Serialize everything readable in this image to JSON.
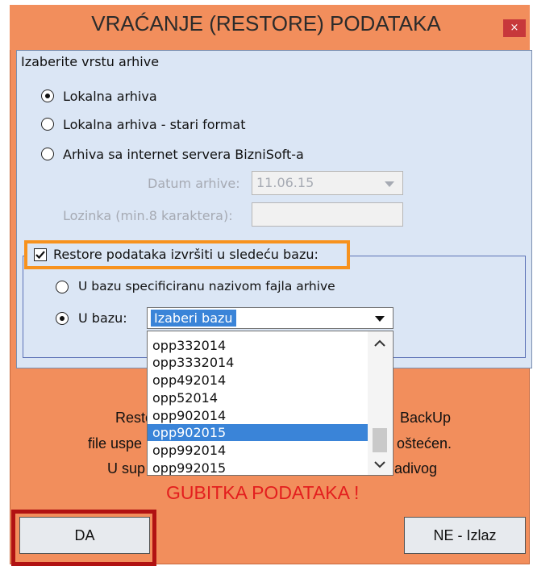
{
  "window": {
    "title": "VRAĆANJE (RESTORE) PODATAKA",
    "close_glyph": "×",
    "accent_color": "#f28e5c"
  },
  "archive_type": {
    "heading": "Izaberite vrstu arhive",
    "options": [
      {
        "label": "Lokalna arhiva",
        "selected": true
      },
      {
        "label": "Lokalna arhiva - stari format",
        "selected": false
      },
      {
        "label": "Arhiva sa internet servera BizniSoft-a",
        "selected": false
      }
    ],
    "date_label": "Datum arhive:",
    "date_value": "11.06.15",
    "password_label": "Lozinka (min.8 karaktera):",
    "password_value": ""
  },
  "restore_target": {
    "checkbox_label": "Restore podataka izvršiti u sledeću bazu:",
    "checked": true,
    "options": [
      {
        "label": "U bazu specificiranu nazivom fajla arhive",
        "selected": false
      },
      {
        "label": "U bazu:",
        "selected": true
      }
    ],
    "combo_value": "Izaberi bazu",
    "dropdown_items": [
      {
        "label": "opp332014",
        "selected": false
      },
      {
        "label": "opp3332014",
        "selected": false
      },
      {
        "label": "opp492014",
        "selected": false
      },
      {
        "label": "opp52014",
        "selected": false
      },
      {
        "label": "opp902014",
        "selected": false
      },
      {
        "label": "opp902015",
        "selected": true
      },
      {
        "label": "opp992014",
        "selected": false
      },
      {
        "label": "opp992015",
        "selected": false
      }
    ]
  },
  "message": {
    "line1_left": "Restore",
    "line1_right": "BackUp",
    "line2_left": "file uspe",
    "line2_right": "oštećen.",
    "line3_left": "U sup",
    "line3_right": "adivog",
    "warning": "GUBITKA PODATAKA !"
  },
  "buttons": {
    "yes": "DA",
    "no": "NE - Izlaz"
  }
}
